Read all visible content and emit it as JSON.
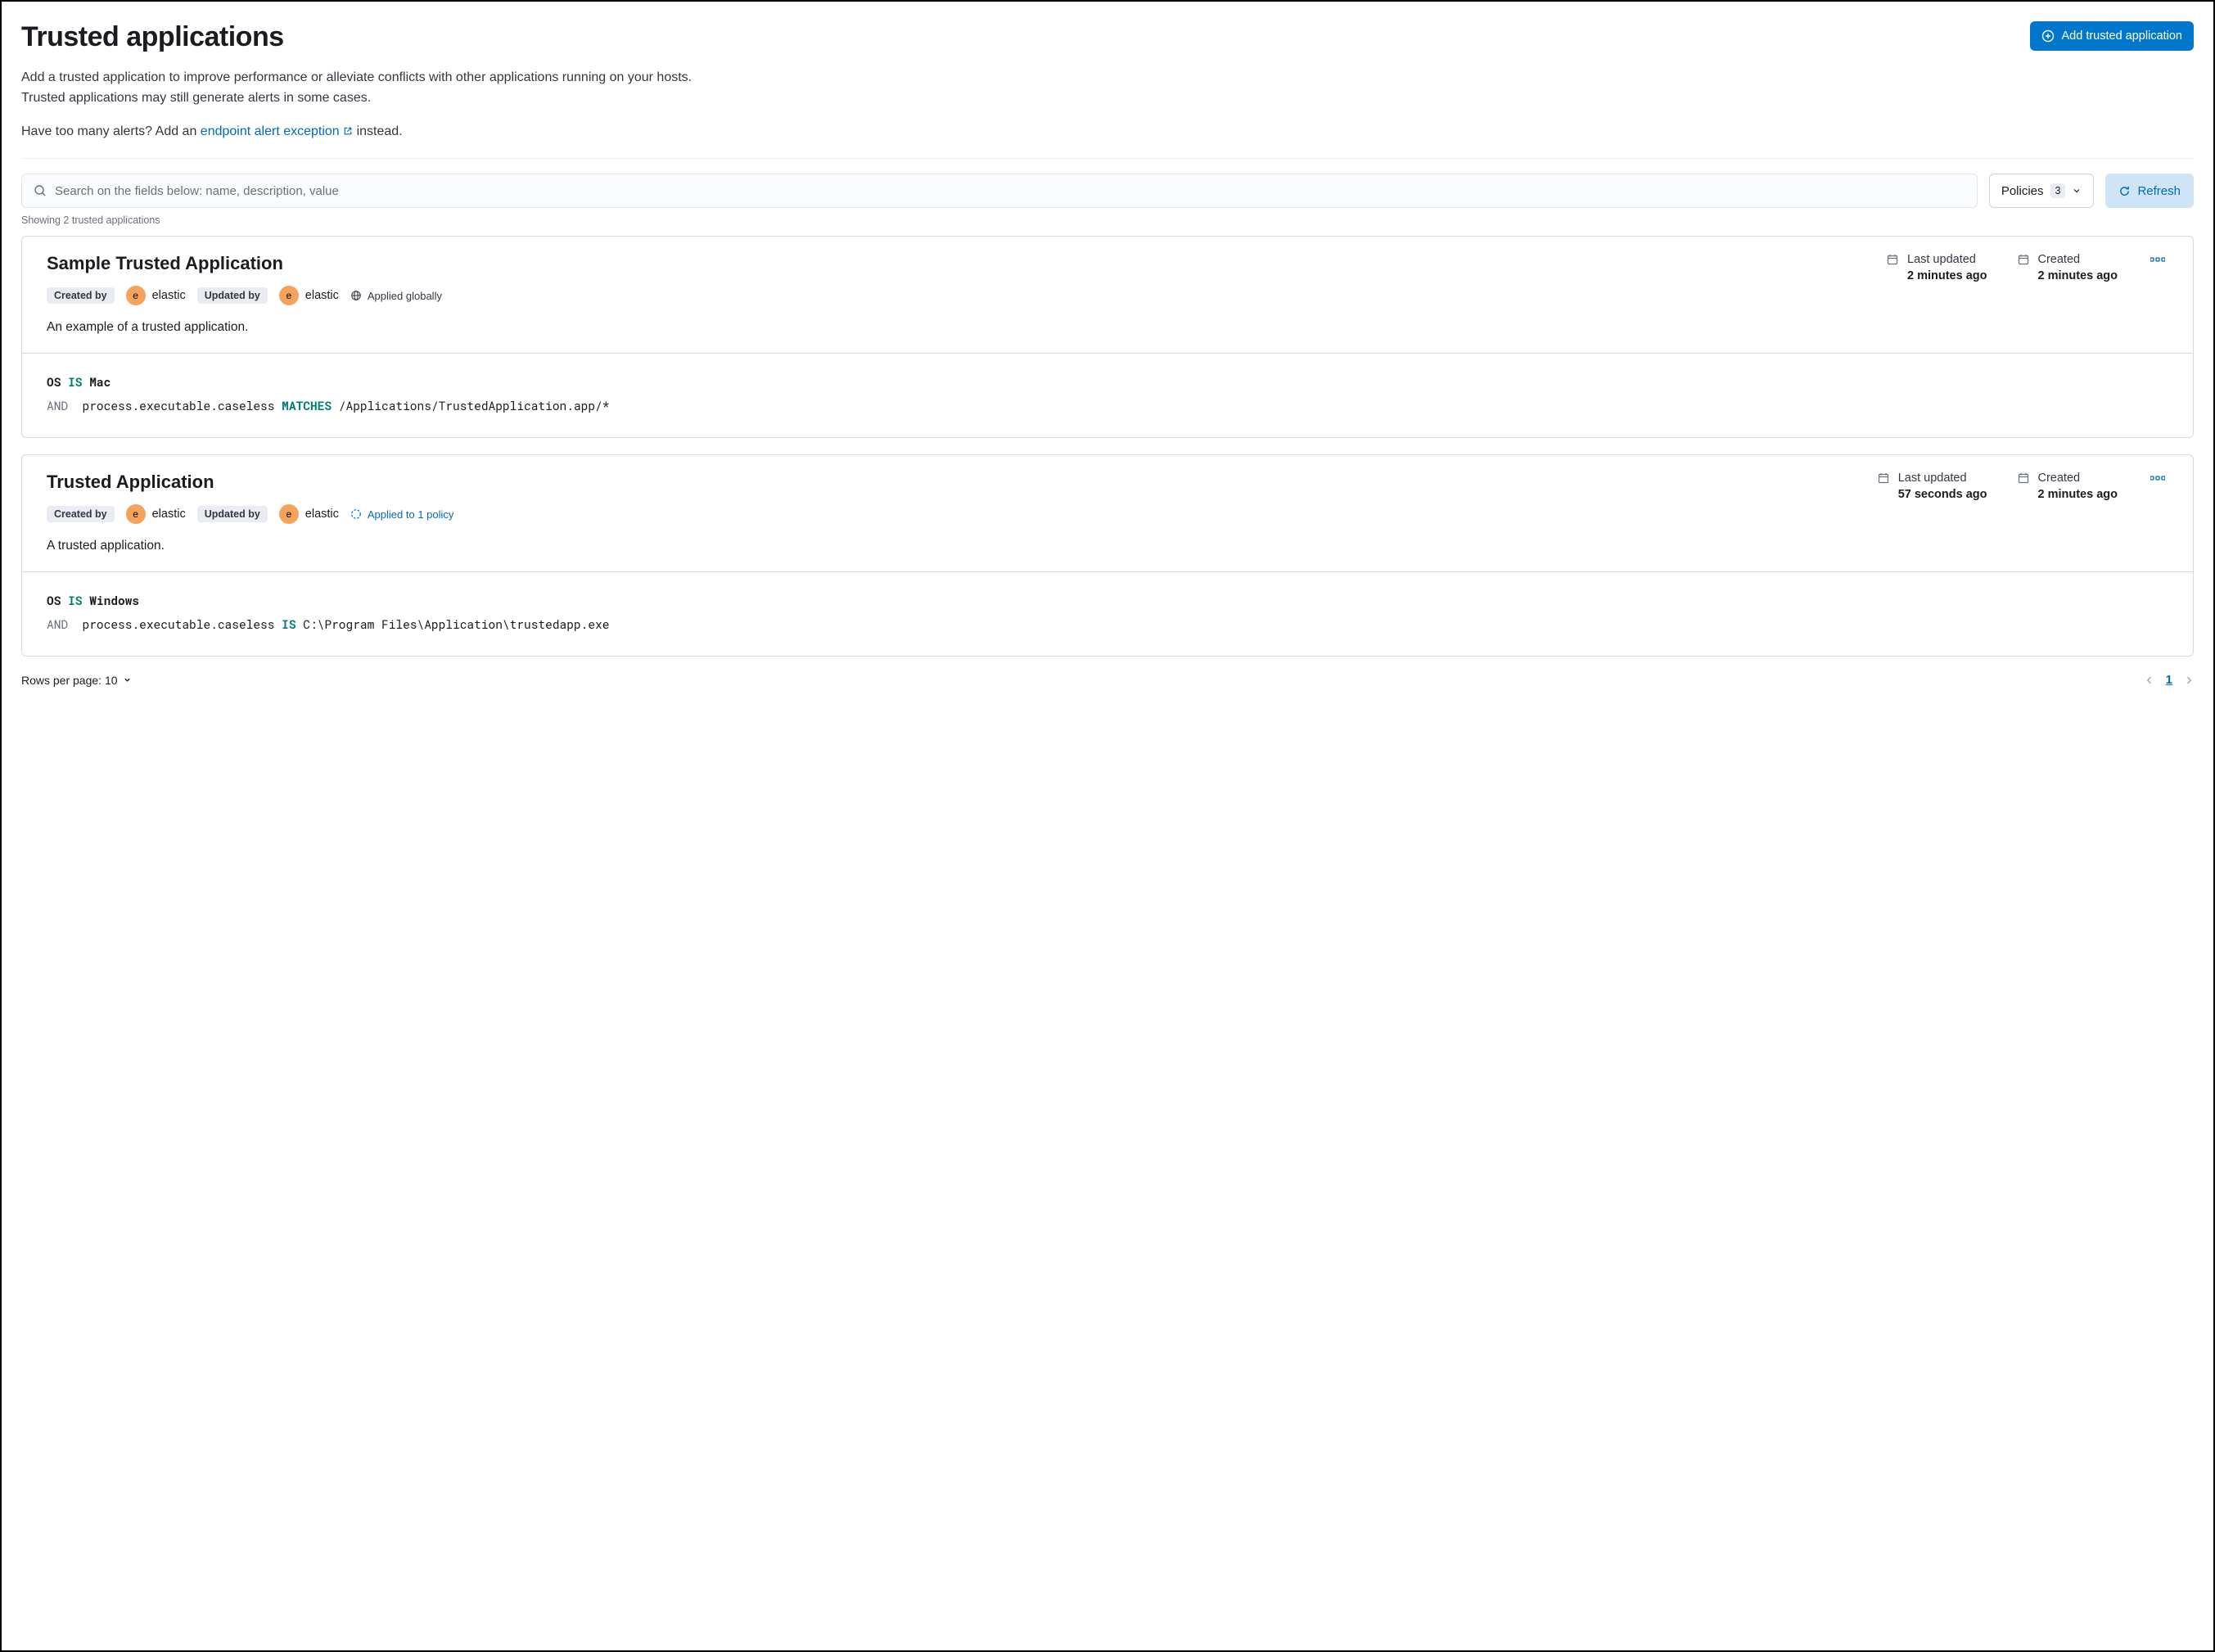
{
  "header": {
    "title": "Trusted applications",
    "add_button": "Add trusted application"
  },
  "intro": {
    "line1a": "Add a trusted application to improve performance or alleviate conflicts with other applications running on your hosts. Trusted applications may still generate alerts in some cases.",
    "line2_pre": "Have too many alerts? Add an ",
    "line2_link": "endpoint alert exception",
    "line2_post": " instead."
  },
  "toolbar": {
    "search_placeholder": "Search on the fields below: name, description, value",
    "policies_label": "Policies",
    "policies_count": "3",
    "refresh_label": "Refresh"
  },
  "result_count": "Showing 2 trusted applications",
  "cards": [
    {
      "title": "Sample Trusted Application",
      "created_by_label": "Created by",
      "created_by_initial": "e",
      "created_by_user": "elastic",
      "updated_by_label": "Updated by",
      "updated_by_initial": "e",
      "updated_by_user": "elastic",
      "scope_type": "global",
      "scope_text": "Applied globally",
      "description": "An example of a trusted application.",
      "last_updated_label": "Last updated",
      "last_updated_value": "2 minutes ago",
      "created_label": "Created",
      "created_value": "2 minutes ago",
      "cond_line1_field": "OS",
      "cond_line1_op": "IS",
      "cond_line1_val": "Mac",
      "cond_line2_and": "AND",
      "cond_line2_field": "process.executable.caseless",
      "cond_line2_op": "MATCHES",
      "cond_line2_val": "/Applications/TrustedApplication.app/*"
    },
    {
      "title": "Trusted Application",
      "created_by_label": "Created by",
      "created_by_initial": "e",
      "created_by_user": "elastic",
      "updated_by_label": "Updated by",
      "updated_by_initial": "e",
      "updated_by_user": "elastic",
      "scope_type": "policy",
      "scope_text": "Applied to 1 policy",
      "description": "A trusted application.",
      "last_updated_label": "Last updated",
      "last_updated_value": "57 seconds ago",
      "created_label": "Created",
      "created_value": "2 minutes ago",
      "cond_line1_field": "OS",
      "cond_line1_op": "IS",
      "cond_line1_val": "Windows",
      "cond_line2_and": "AND",
      "cond_line2_field": "process.executable.caseless",
      "cond_line2_op": "IS",
      "cond_line2_val": "C:\\Program Files\\Application\\trustedapp.exe"
    }
  ],
  "pager": {
    "rows_label": "Rows per page: 10",
    "current_page": "1"
  }
}
